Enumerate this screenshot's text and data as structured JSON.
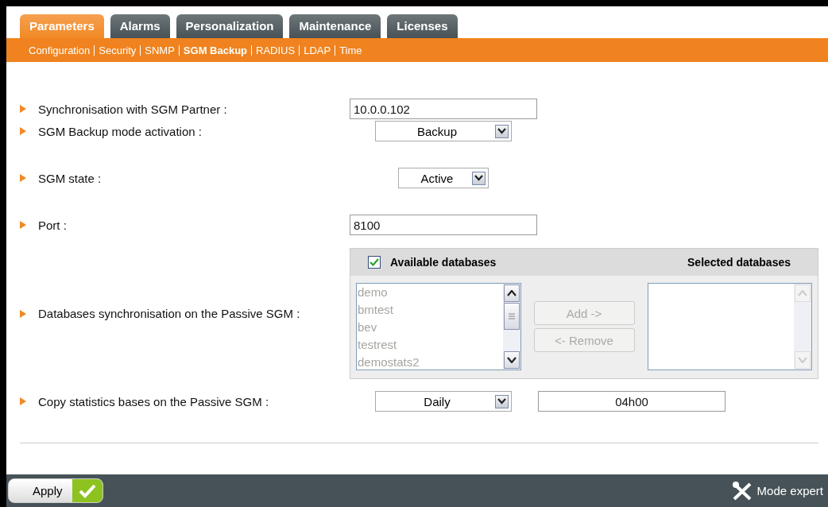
{
  "tabs": [
    {
      "label": "Parameters",
      "selected": true
    },
    {
      "label": "Alarms",
      "selected": false
    },
    {
      "label": "Personalization",
      "selected": false
    },
    {
      "label": "Maintenance",
      "selected": false
    },
    {
      "label": "Licenses",
      "selected": false
    }
  ],
  "subnav": [
    {
      "label": "Configuration",
      "selected": false
    },
    {
      "label": "Security",
      "selected": false
    },
    {
      "label": "SNMP",
      "selected": false
    },
    {
      "label": "SGM Backup",
      "selected": true
    },
    {
      "label": "RADIUS",
      "selected": false
    },
    {
      "label": "LDAP",
      "selected": false
    },
    {
      "label": "Time",
      "selected": false
    }
  ],
  "rows": [
    {
      "kind": "text",
      "label": "Synchronisation with SGM Partner :",
      "value": "10.0.0.102"
    },
    {
      "kind": "select",
      "label": "SGM Backup mode activation :",
      "value": "Backup"
    },
    {
      "kind": "select",
      "label": "SGM state :",
      "value": "Active"
    },
    {
      "kind": "text",
      "label": "Port :",
      "value": "8100"
    },
    {
      "kind": "databases",
      "label": "Databases synchronisation on the Passive SGM :",
      "available_header": "Available databases",
      "checked": true,
      "selected_header": "Selected databases",
      "available": [
        "demo",
        "bmtest",
        "bev",
        "testrest",
        "demostats2"
      ],
      "buttons": [
        {
          "label": "Add ->",
          "disabled": true
        },
        {
          "label": "<- Remove",
          "disabled": true
        }
      ]
    },
    {
      "kind": "schedule",
      "label": "Copy statistics bases on the Passive SGM :",
      "value": "Daily",
      "time": "04h00"
    }
  ],
  "footer": {
    "apply": "Apply",
    "mode_expert": "Mode expert"
  }
}
